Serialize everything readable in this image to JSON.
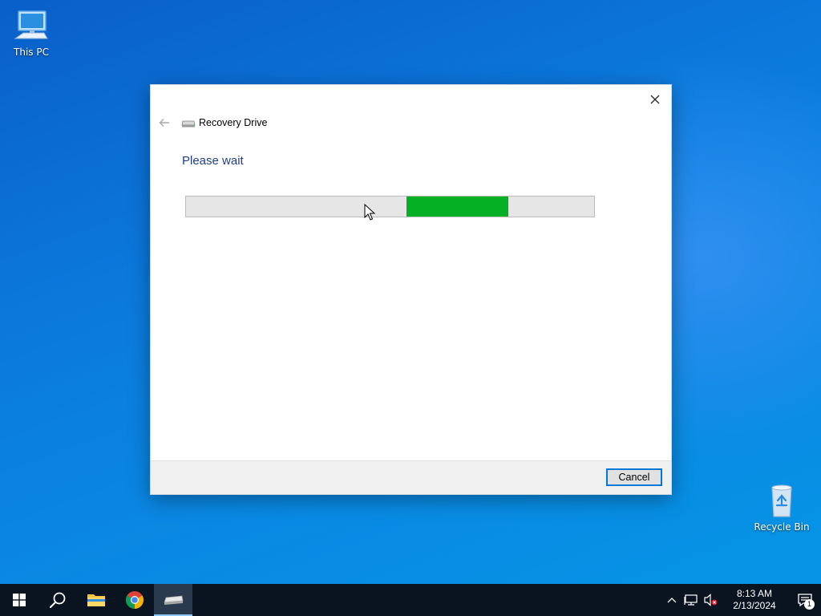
{
  "desktop": {
    "icons": [
      {
        "label": "This PC"
      },
      {
        "label": "Recycle Bin"
      }
    ]
  },
  "dialog": {
    "title": "Recovery Drive",
    "heading": "Please wait",
    "progress": {
      "mode": "indeterminate",
      "chunk_start_percent": 54,
      "chunk_width_percent": 25,
      "color": "#06b025"
    },
    "cancel_label": "Cancel"
  },
  "taskbar": {
    "apps": [
      "start-icon",
      "search-icon",
      "file-explorer-icon",
      "chrome-icon",
      "recovery-drive-icon"
    ],
    "clock": {
      "time": "8:13 AM",
      "date": "2/13/2024"
    },
    "notification_count": "1"
  },
  "colors": {
    "accent": "#0078d7",
    "heading": "#1e3f8a",
    "progress": "#06b025",
    "taskbar": "#0a1420"
  }
}
